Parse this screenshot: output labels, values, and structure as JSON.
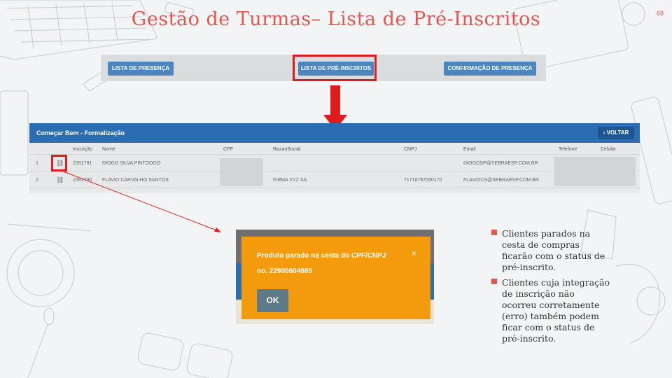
{
  "slide": {
    "title": "Gestão de Turmas– Lista de Pré-Inscritos",
    "number": "68"
  },
  "tabs": {
    "lista_presenca": "LISTA DE PRESENÇA",
    "lista_pre_inscritos": "LISTA DE PRÉ-INSCRITOS",
    "confirmacao_presenca": "CONFIRMAÇÃO DE PRESENÇA"
  },
  "panel": {
    "title": "Começar Bem - Formalização",
    "back_button": "VOLTAR",
    "columns": {
      "inscricao": "Inscrição",
      "nome": "Nome",
      "cpf": "CPF",
      "razao": "RazaoSocial",
      "cnpj": "CNPJ",
      "email": "Email",
      "telefone": "Telefone",
      "celular": "Celular"
    },
    "rows": [
      {
        "num": "1",
        "inscricao": "2391791",
        "nome": "DIOGO SILVA PINTOOOO",
        "razao": "",
        "cnpj": "",
        "email": "DIOGOSP@SEBRAESP.COM.BR"
      },
      {
        "num": "2",
        "inscricao": "2391790",
        "nome": "FLAVIO CARVALHO SANTOS",
        "razao": "FIRMA XYZ SA",
        "cnpj": "71718787000170",
        "email": "FLAVIOCS@SEBRAESP.COM.BR"
      }
    ],
    "row_icon": "link-icon"
  },
  "modal": {
    "message_line1": "Produto parado na cesta do CPF/CNPJ",
    "message_line2": "no. 22900604885",
    "close": "×",
    "ok": "OK"
  },
  "bullets": [
    "Clientes parados na cesta de compras ficarão com o status de pré-inscrito.",
    "Clientes cuja integração de inscrição não ocorreu corretamente (erro) também podem ficar com o status de pré-inscrito."
  ],
  "colors": {
    "accent": "#e2574c",
    "highlight": "#e01b1b",
    "header_blue": "#2b6db2",
    "button_blue": "#4b86bf",
    "modal_orange": "#f39a0d",
    "ok_button": "#5d7a88"
  }
}
